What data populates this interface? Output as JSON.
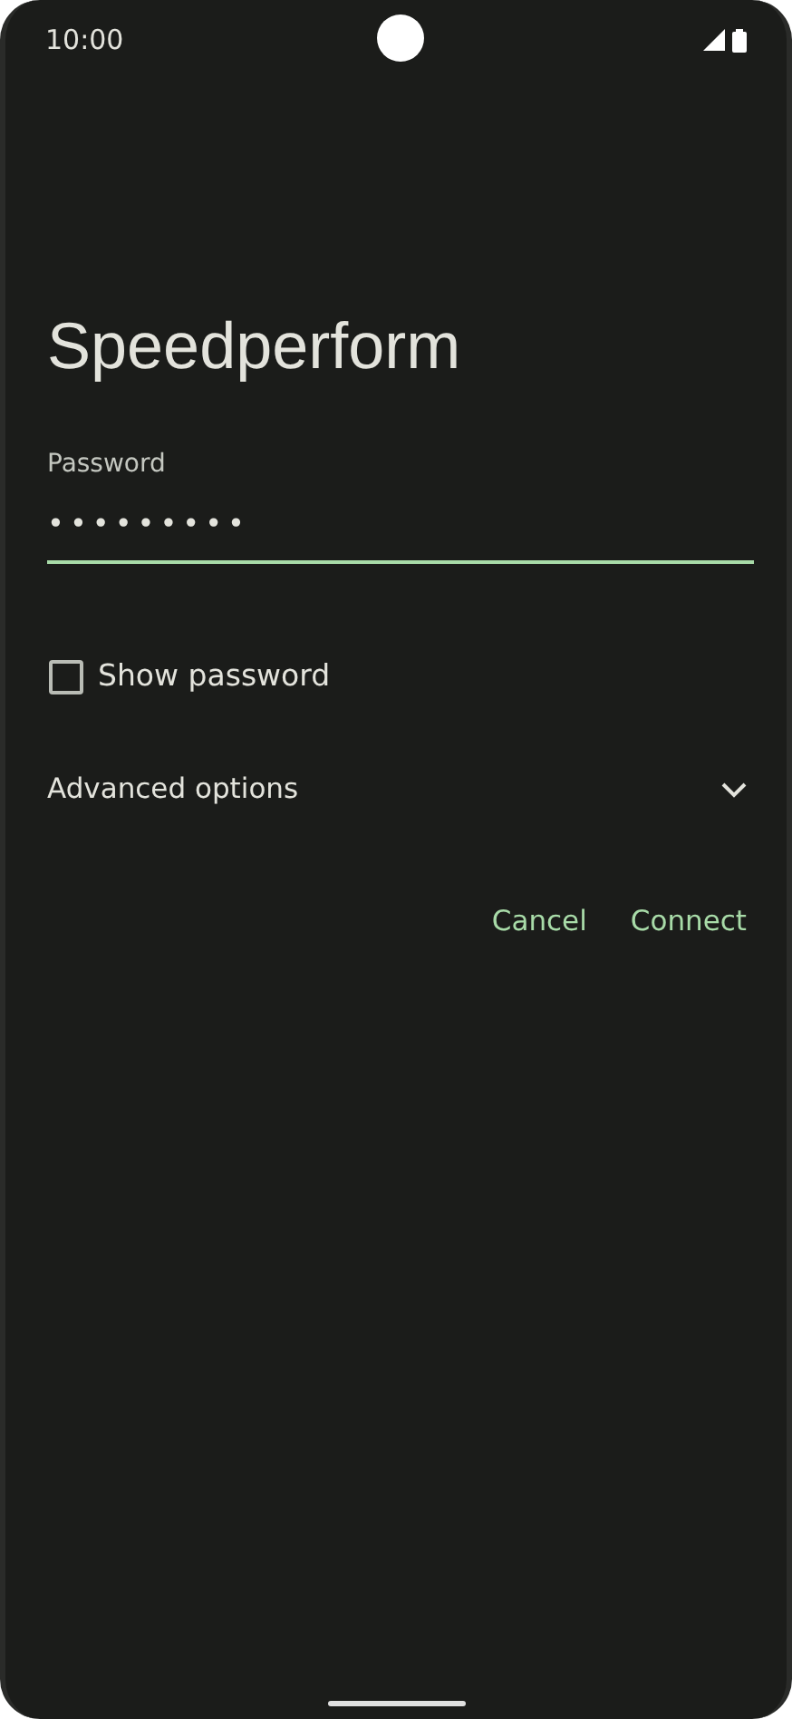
{
  "status_bar": {
    "time": "10:00"
  },
  "dialog": {
    "title": "Speedperform",
    "password": {
      "label": "Password",
      "value": "•••••••••",
      "focused": true
    },
    "show_password": {
      "label": "Show password",
      "checked": false
    },
    "advanced": {
      "label": "Advanced options",
      "expanded": false
    },
    "buttons": [
      {
        "label": "Cancel"
      },
      {
        "label": "Connect"
      }
    ]
  }
}
